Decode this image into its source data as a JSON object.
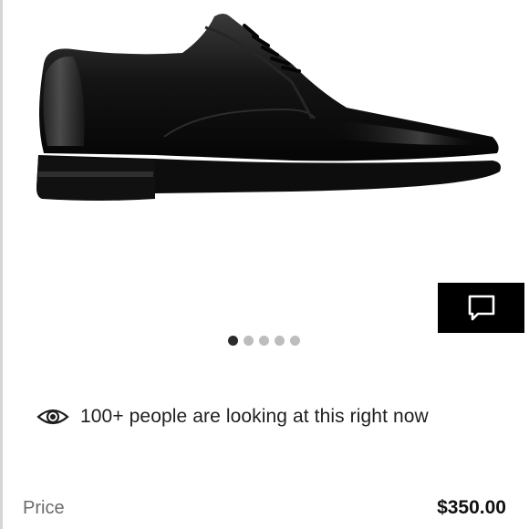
{
  "product": {
    "image_alt": "Black leather Derby shoe",
    "carousel": {
      "total": 5,
      "active_index": 0
    }
  },
  "chat": {
    "icon": "chat-bubble-icon"
  },
  "social_proof": {
    "icon": "eye-icon",
    "text": "100+ people are looking at this right now"
  },
  "price": {
    "label": "Price",
    "value": "$350.00"
  },
  "colors": {
    "accent": "#000000",
    "dot_active": "#2b2b2b",
    "dot_inactive": "#bdbdbd"
  }
}
